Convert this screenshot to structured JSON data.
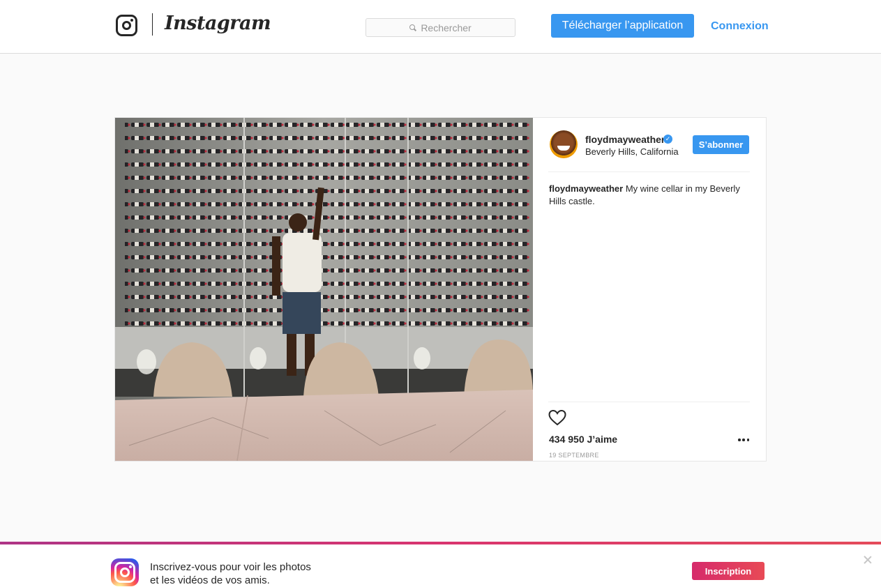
{
  "header": {
    "wordmark": "Instagram",
    "search_placeholder": "Rechercher",
    "download_app_label": "Télécharger l’application",
    "login_label": "Connexion"
  },
  "post": {
    "username": "floydmayweather",
    "verified": true,
    "location": "Beverly Hills, California",
    "follow_label": "S’abonner",
    "caption_author": "floydmayweather",
    "caption_text": "My wine cellar in my Beverly Hills castle.",
    "likes_text": "434 950 J’aime",
    "date": "19 SEPTEMBRE"
  },
  "banner": {
    "line1": "Inscrivez-vous pour voir les photos",
    "line2": "et les vidéos de vos amis.",
    "signup_label": "Inscription"
  },
  "colors": {
    "accent_blue": "#3897f0",
    "signup_gradient_start": "#d62a6b",
    "signup_gradient_end": "#e84a56"
  }
}
